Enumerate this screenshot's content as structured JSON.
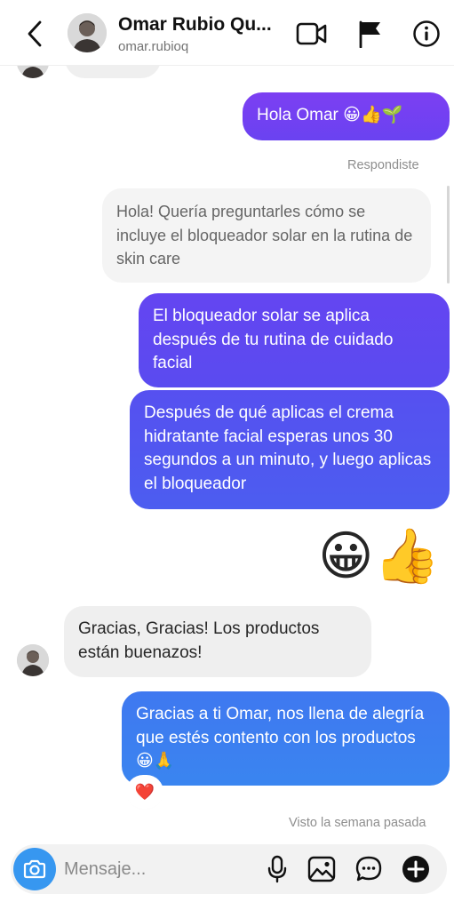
{
  "header": {
    "back_icon": "chevron-left-icon",
    "contact_name": "Omar Rubio Qu...",
    "username": "omar.rubioq",
    "video_icon": "video-camera-icon",
    "flag_icon": "flag-icon",
    "info_icon": "info-icon"
  },
  "messages": [
    {
      "from": "me",
      "text": "Hola Omar 😀👍🌱"
    },
    {
      "status": "Respondiste"
    },
    {
      "from": "them",
      "text": "Hola! Quería preguntarles cómo se incluye el bloqueador solar en la rutina de skin care",
      "style": "reply-quote"
    },
    {
      "from": "me",
      "text": "El bloqueador solar se aplica después de tu rutina de cuidado facial"
    },
    {
      "from": "me",
      "text": "Después de qué aplicas el crema hidratante facial esperas unos 30 segundos a un minuto, y luego aplicas el bloqueador"
    },
    {
      "from": "me",
      "text": "😀👍",
      "style": "large-emoji"
    },
    {
      "from": "them",
      "text": "Gracias, Gracias! Los productos están buenazos!"
    },
    {
      "from": "me",
      "text": "Gracias a ti Omar, nos llena de alegría que estés contento con los productos 😀🙏",
      "reaction": "❤️"
    },
    {
      "status": "Visto la semana pasada"
    }
  ],
  "composer": {
    "placeholder": "Mensaje...",
    "camera_icon": "camera-icon",
    "mic_icon": "microphone-icon",
    "gallery_icon": "image-icon",
    "sticker_icon": "chat-bubble-icon",
    "add_icon": "plus-circle-icon"
  },
  "colors": {
    "gradient_top": "#7b3ff2",
    "gradient_mid": "#5a4cf0",
    "gradient_bottom": "#3b82f0",
    "incoming_bg": "#efefef",
    "camera_blue": "#3797f0"
  }
}
